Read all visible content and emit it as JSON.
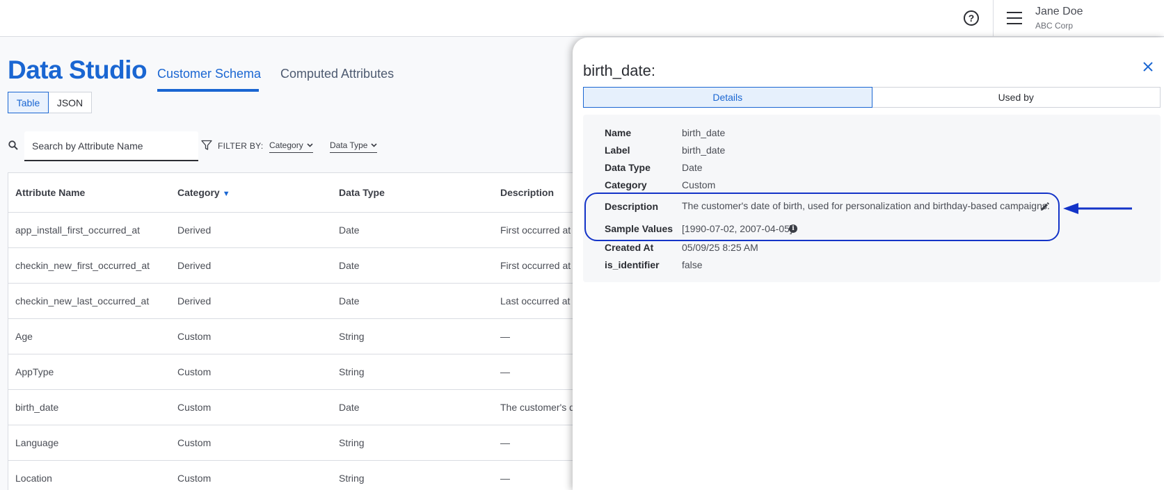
{
  "header": {
    "help_icon": "question-circle",
    "menu_icon": "hamburger",
    "user_name": "Jane Doe",
    "user_org": "ABC Corp"
  },
  "app": {
    "title": "Data Studio",
    "tabs": [
      {
        "label": "Customer Schema",
        "active": true
      },
      {
        "label": "Computed Attributes",
        "active": false
      }
    ],
    "view_toggle": {
      "table": "Table",
      "json": "JSON",
      "selected": "Table"
    }
  },
  "toolbar": {
    "search_placeholder": "Search by Attribute Name",
    "filter_label": "FILTER BY:",
    "filters": [
      "Category",
      "Data Type"
    ]
  },
  "table": {
    "headers": [
      "Attribute Name",
      "Category",
      "Data Type",
      "Description"
    ],
    "sorted_by": "Category",
    "rows": [
      [
        "app_install_first_occurred_at",
        "Derived",
        "Date",
        "First occurred at t"
      ],
      [
        "checkin_new_first_occurred_at",
        "Derived",
        "Date",
        "First occurred at t"
      ],
      [
        "checkin_new_last_occurred_at",
        "Derived",
        "Date",
        "Last occurred at t"
      ],
      [
        "Age",
        "Custom",
        "String",
        "—"
      ],
      [
        "AppType",
        "Custom",
        "String",
        "—"
      ],
      [
        "birth_date",
        "Custom",
        "Date",
        "The customer's d"
      ],
      [
        "Language",
        "Custom",
        "String",
        "—"
      ],
      [
        "Location",
        "Custom",
        "String",
        "—"
      ]
    ]
  },
  "drawer": {
    "title": "birth_date:",
    "tabs": {
      "details": "Details",
      "used_by": "Used by",
      "selected": "Details"
    },
    "fields": [
      {
        "label": "Name",
        "value": "birth_date"
      },
      {
        "label": "Label",
        "value": "birth_date"
      },
      {
        "label": "Data Type",
        "value": "Date"
      },
      {
        "label": "Category",
        "value": "Custom"
      },
      {
        "label": "Description",
        "value": "The customer's date of birth, used for personalization and birthday-based campaigns."
      },
      {
        "label": "Sample Values",
        "value": "[1990-07-02, 2007-04-05]"
      },
      {
        "label": "Created At",
        "value": "05/09/25 8:25 AM"
      },
      {
        "label": "is_identifier",
        "value": "false"
      }
    ]
  },
  "colors": {
    "accent": "#1a66d2",
    "highlight": "#1434c8"
  }
}
